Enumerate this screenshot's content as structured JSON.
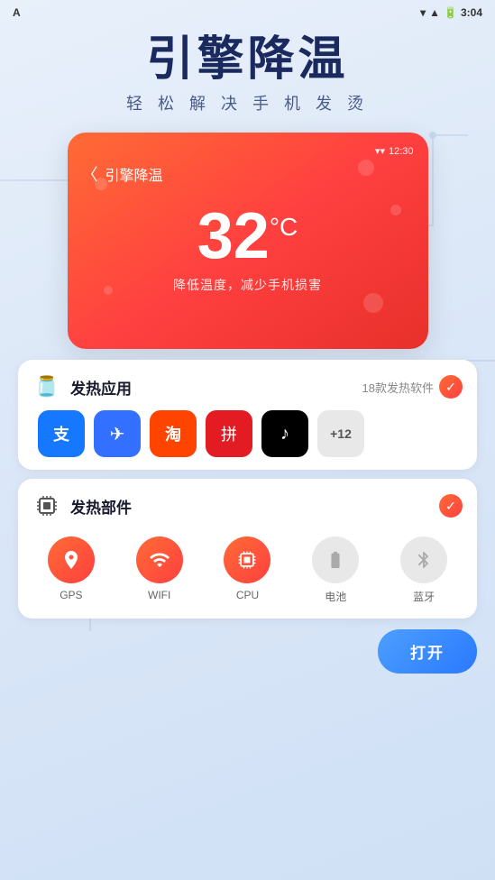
{
  "statusBar": {
    "appName": "A",
    "time": "3:04",
    "signals": "▲▼"
  },
  "hero": {
    "title": "引擎降温",
    "subtitle": "轻 松 解 决 手 机 发 烫"
  },
  "phoneMockup": {
    "statusTime": "12:30",
    "headerBack": "〈",
    "headerTitle": "引擎降温",
    "temperature": "32",
    "tempUnit": "°C",
    "description": "降低温度，减少手机损害"
  },
  "heatingApps": {
    "iconSymbol": "🫙",
    "title": "发热应用",
    "badge": "18款发热软件",
    "apps": [
      {
        "name": "alipay",
        "label": "支付宝",
        "symbol": "支",
        "color": "#1677FF"
      },
      {
        "name": "feishu",
        "label": "飞书",
        "symbol": "✈",
        "color": "#3370FF"
      },
      {
        "name": "taobao",
        "label": "淘宝",
        "symbol": "淘",
        "color": "#FF4400"
      },
      {
        "name": "pinduoduo",
        "label": "拼多多",
        "symbol": "拼",
        "color": "#E31B23"
      },
      {
        "name": "tiktok",
        "label": "抖音",
        "symbol": "♪",
        "color": "#000000"
      },
      {
        "name": "more",
        "label": "+12",
        "symbol": "+12",
        "color": "#e8e8e8"
      }
    ]
  },
  "heatingComponents": {
    "iconSymbol": "⊙",
    "title": "发热部件",
    "components": [
      {
        "name": "gps",
        "label": "GPS",
        "active": true,
        "symbol": "➤"
      },
      {
        "name": "wifi",
        "label": "WIFI",
        "active": true,
        "symbol": "📶"
      },
      {
        "name": "cpu",
        "label": "CPU",
        "active": true,
        "symbol": "⬡"
      },
      {
        "name": "battery",
        "label": "电池",
        "active": false,
        "symbol": "▭"
      },
      {
        "name": "bluetooth",
        "label": "蓝牙",
        "active": false,
        "symbol": "𝐁"
      }
    ]
  },
  "openButton": {
    "label": "打开"
  }
}
